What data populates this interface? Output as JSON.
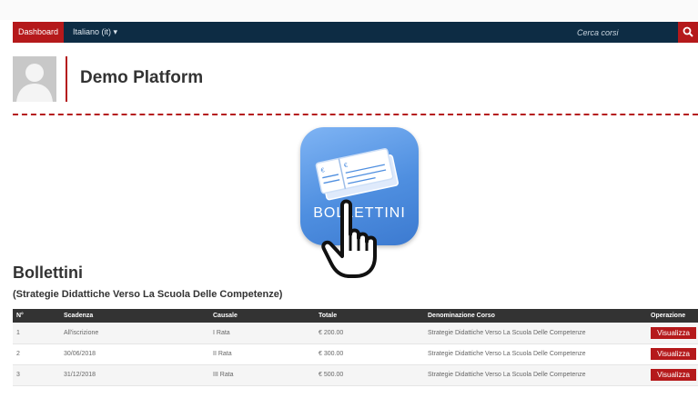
{
  "nav": {
    "dashboard_label": "Dashboard",
    "language_label": "Italiano (it)",
    "search_placeholder": "Cerca corsi"
  },
  "header": {
    "platform_name": "Demo Platform"
  },
  "feature_icon": {
    "label": "BOLLETTINI",
    "icon": "bollettini-tickets-icon",
    "pointer_icon": "pointing-hand-icon"
  },
  "section": {
    "title": "Bollettini",
    "subtitle": "(Strategie Didattiche Verso La Scuola Delle Competenze)"
  },
  "table": {
    "columns": [
      "N°",
      "Scadenza",
      "Causale",
      "Totale",
      "Denominazione Corso",
      "Operazione"
    ],
    "rows": [
      {
        "n": "1",
        "scadenza": "All'iscrizione",
        "causale": "I Rata",
        "totale": "€ 200.00",
        "corso": "Strategie Didattiche Verso La Scuola Delle Competenze",
        "azione": "Visualizza"
      },
      {
        "n": "2",
        "scadenza": "30/06/2018",
        "causale": "II Rata",
        "totale": "€ 300.00",
        "corso": "Strategie Didattiche Verso La Scuola Delle Competenze",
        "azione": "Visualizza"
      },
      {
        "n": "3",
        "scadenza": "31/12/2018",
        "causale": "III Rata",
        "totale": "€ 500.00",
        "corso": "Strategie Didattiche Verso La Scuola Delle Competenze",
        "azione": "Visualizza"
      }
    ]
  },
  "colors": {
    "accent": "#b5191b",
    "navbar": "#0d2c44",
    "icon_blue": "#4f8fe0"
  }
}
